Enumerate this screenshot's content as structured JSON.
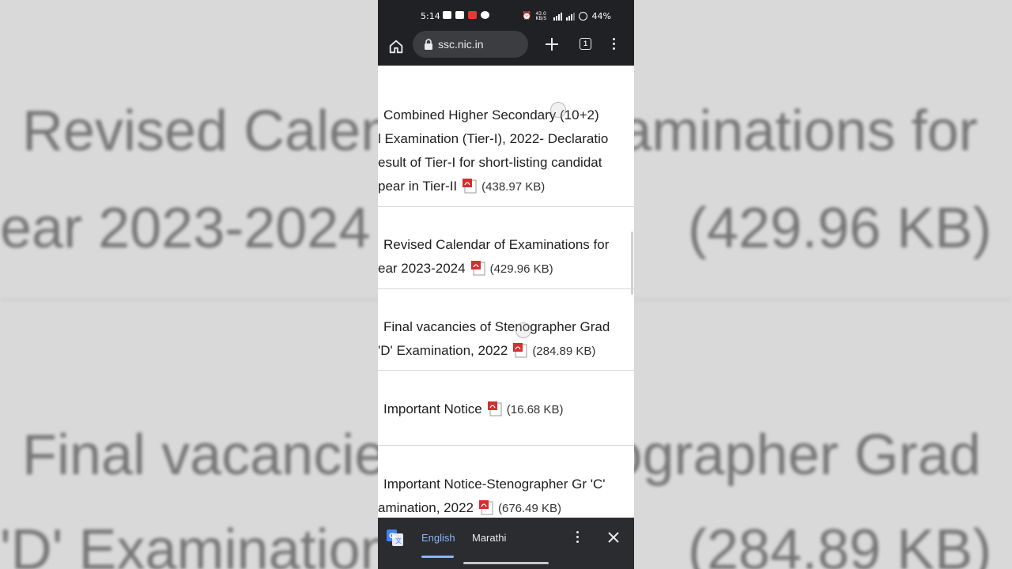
{
  "status_bar": {
    "time": "5:14",
    "speed": "43.0 KB/S",
    "battery": "44%"
  },
  "browser": {
    "url": "ssc.nic.in",
    "tab_count": "1"
  },
  "notices": [
    {
      "lines": [
        "Combined Higher Secondary (10+2)",
        "l Examination (Tier-I), 2022- Declaratio",
        "esult of Tier-I for short-listing candidat",
        "pear in Tier-II"
      ],
      "size": "(438.97 KB)"
    },
    {
      "lines": [
        "Revised Calendar of Examinations for",
        "ear 2023-2024"
      ],
      "size": "(429.96 KB)"
    },
    {
      "lines": [
        "Final vacancies of Stenographer Grad",
        "'D' Examination, 2022"
      ],
      "size": "(284.89 KB)"
    },
    {
      "lines": [
        "Important Notice"
      ],
      "size": "(16.68 KB)"
    },
    {
      "lines": [
        "Important Notice-Stenographer Gr 'C'",
        "amination, 2022"
      ],
      "size": "(676.49 KB)"
    }
  ],
  "translate_bar": {
    "source_lang": "English",
    "target_lang": "Marathi"
  },
  "background_zoom": {
    "line1": "Revised Calendar of Examinations for",
    "line2": "ear 2023-2024",
    "size1": "(429.96 KB)",
    "line3": "Final vacancies of Stenographer Grad",
    "line4": "'D' Examination",
    "size2": "(284.89 KB)"
  },
  "colors": {
    "chrome_dark": "#202124",
    "link_blue": "#8ab4f8",
    "pdf_red": "#d32f2f"
  }
}
